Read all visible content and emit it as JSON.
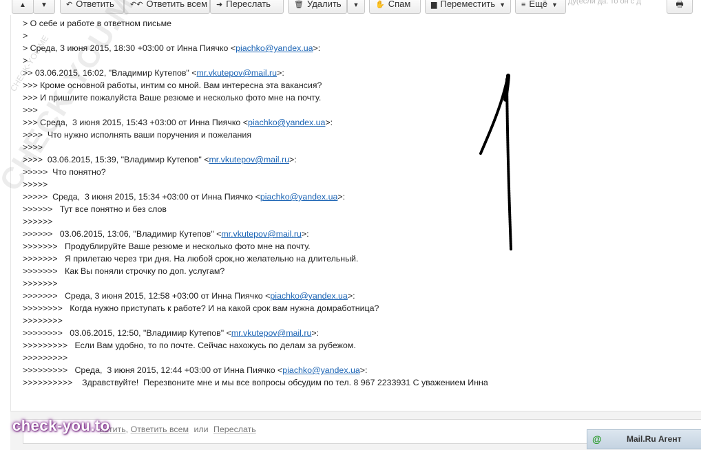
{
  "toolbar": {
    "up_icon": "arrow-up",
    "down_icon": "arrow-down",
    "reply_label": "Ответить",
    "reply_all_label": "Ответить всем",
    "forward_label": "Переслать",
    "delete_label": "Удалить",
    "spam_label": "Спам",
    "move_label": "Переместить",
    "more_label": "Ещё",
    "cut_note": "ду(если да. то он с д"
  },
  "message": {
    "lines": [
      {
        "text": "> О себе и работе в ответном письме"
      },
      {
        "text": ">"
      },
      {
        "pre": "> Среда, 3 июня 2015, 18:30 +03:00 от Инна Пиячко <",
        "email": "piachko@yandex.ua",
        "post": ">:"
      },
      {
        "text": ">"
      },
      {
        "pre": ">> 03.06.2015, 16:02, \"Владимир Кутепов\" <",
        "email": "mr.vkutepov@mail.ru",
        "post": ">:"
      },
      {
        "text": ">>> Кроме основной работы, интим со мной. Вам интересна эта вакансия?"
      },
      {
        "text": ">>> И пришлите пожалуйста Ваше резюме и несколько фото мне на почту."
      },
      {
        "text": ">>>"
      },
      {
        "pre": ">>> Среда,  3 июня 2015, 15:43 +03:00 от Инна Пиячко <",
        "email": "piachko@yandex.ua",
        "post": ">:"
      },
      {
        "text": ">>>>  Что нужно исполнять ваши поручения и пожелания"
      },
      {
        "text": ">>>>"
      },
      {
        "pre": ">>>>  03.06.2015, 15:39, \"Владимир Кутепов\" <",
        "email": "mr.vkutepov@mail.ru",
        "post": ">:"
      },
      {
        "text": ">>>>>  Что понятно?"
      },
      {
        "text": ">>>>>"
      },
      {
        "pre": ">>>>>  Среда,  3 июня 2015, 15:34 +03:00 от Инна Пиячко <",
        "email": "piachko@yandex.ua",
        "post": ">:"
      },
      {
        "text": ">>>>>>   Тут все понятно и без слов"
      },
      {
        "text": ">>>>>>"
      },
      {
        "pre": ">>>>>>   03.06.2015, 13:06, \"Владимир Кутепов\" <",
        "email": "mr.vkutepov@mail.ru",
        "post": ">:"
      },
      {
        "text": ">>>>>>>   Продублируйте Ваше резюме и несколько фото мне на почту."
      },
      {
        "text": ">>>>>>>   Я прилетаю через три дня. На любой срок,но желательно на длительный."
      },
      {
        "text": ">>>>>>>   Как Вы поняли строчку по доп. услугам?"
      },
      {
        "text": ">>>>>>>"
      },
      {
        "pre": ">>>>>>>   Среда, 3 июня 2015, 12:58 +03:00 от Инна Пиячко <",
        "email": "piachko@yandex.ua",
        "post": ">:"
      },
      {
        "text": ">>>>>>>>   Когда нужно приступать к работе? И на какой срок вам нужна домработница?"
      },
      {
        "text": ">>>>>>>>"
      },
      {
        "pre": ">>>>>>>>   03.06.2015, 12:50, \"Владимир Кутепов\" <",
        "email": "mr.vkutepov@mail.ru",
        "post": ">:"
      },
      {
        "text": ">>>>>>>>>   Если Вам удобно, то по почте. Сейчас нахожусь по делам за рубежом."
      },
      {
        "text": ">>>>>>>>>"
      },
      {
        "pre": ">>>>>>>>>   Среда,  3 июня 2015, 12:44 +03:00 от Инна Пиячко <",
        "email": "piachko@yandex.ua",
        "post": ">:"
      },
      {
        "text": ">>>>>>>>>>    Здравствуйте!  Перезвоните мне и мы все вопросы обсудим по тел. 8 967 2233931 С уважением Инна"
      }
    ]
  },
  "reply_bar": {
    "reply_partial": "ветить",
    "comma": ",",
    "reply_all": "Ответить всем",
    "or": "или",
    "forward": "Переслать"
  },
  "watermark": {
    "diagonal": "CHECK-YOU.ME",
    "small": "CHECK-YOU.ME",
    "logo": "check-you.to"
  },
  "agent": {
    "label": "Mail.Ru Агент",
    "icon": "at-icon"
  }
}
